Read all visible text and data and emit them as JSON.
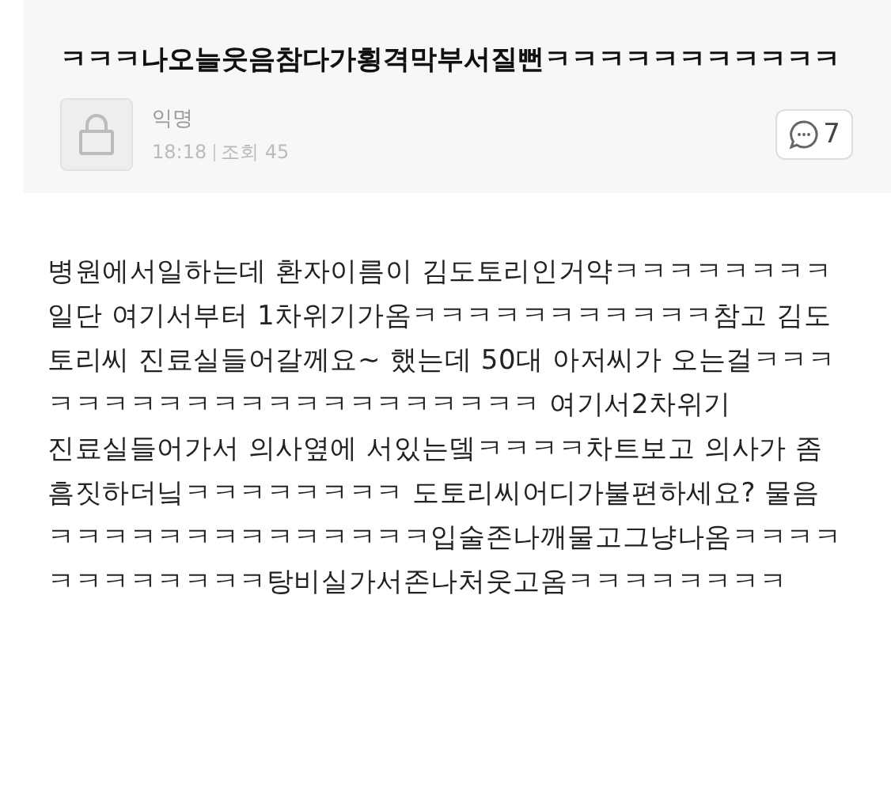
{
  "post": {
    "title": "ㅋㅋㅋ나오늘웃음참다가횡격막부서질뻔ㅋㅋㅋㅋㅋㅋㅋㅋㅋㅋㅋ",
    "author": "익명",
    "time": "18:18",
    "views": "조회 45",
    "comments": "7"
  },
  "body": [
    "병원에서일하는데 환자이름이 김도토리인거약ㅋㅋㅋㅋㅋㅋㅋㅋ일단 여기서부터 1차위기가옴ㅋㅋㅋㅋㅋㅋㅋㅋㅋㅋㅋ참고 김도토리씨 진료실들어갈께요~ 했는데 50대 아저씨가 오는걸ㅋㅋㅋㅋㅋㅋㅋㅋㅋㅋㅋㅋㅋㅋㅋㅋㅋㅋㅋㅋㅋ 여기서2차위기",
    "진료실들어가서 의사옆에 서있는뎈ㅋㅋㅋㅋ차트보고 의사가 좀 흠짓하더닠ㅋㅋㅋㅋㅋㅋㅋㅋ 도토리씨어디가불편하세요? 물음ㅋㅋㅋㅋㅋㅋㅋㅋㅋㅋㅋㅋㅋㅋ입술존나깨물고그냥나옴ㅋㅋㅋㅋㅋㅋㅋㅋㅋㅋㅋㅋ탕비실가서존나처웃고옴ㅋㅋㅋㅋㅋㅋㅋㅋ"
  ]
}
